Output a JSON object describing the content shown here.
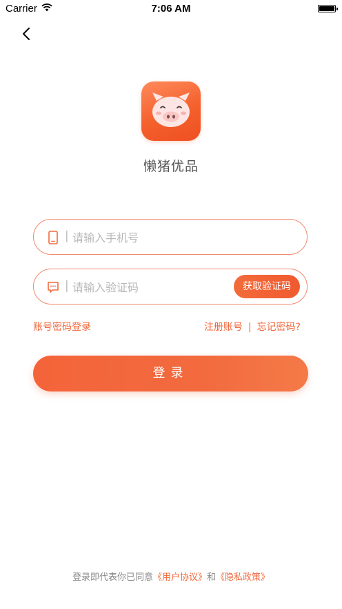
{
  "status": {
    "carrier": "Carrier",
    "time": "7:06 AM",
    "battery_level": 1.0
  },
  "nav": {
    "back_icon": "chevron-left-icon"
  },
  "app": {
    "name": "懒猪优品",
    "logo_icon": "pig-face-icon"
  },
  "phone_field": {
    "icon": "phone-icon",
    "placeholder": "请输入手机号",
    "separator": "|"
  },
  "code_field": {
    "icon": "message-icon",
    "placeholder": "请输入验证码",
    "separator": "|",
    "get_code_label": "获取验证码"
  },
  "links": {
    "password_login": "账号密码登录",
    "register": "注册账号",
    "divider": "|",
    "forgot_password": "忘记密码?"
  },
  "login_button": {
    "label": "登录"
  },
  "agreement": {
    "prefix": "登录即代表你已同意",
    "user_agreement": "《用户协议》",
    "conjunction": "和",
    "privacy_policy": "《隐私政策》"
  },
  "colors": {
    "accent": "#f26a3e",
    "field_border": "#f0896a",
    "placeholder": "#b8b8b8"
  }
}
